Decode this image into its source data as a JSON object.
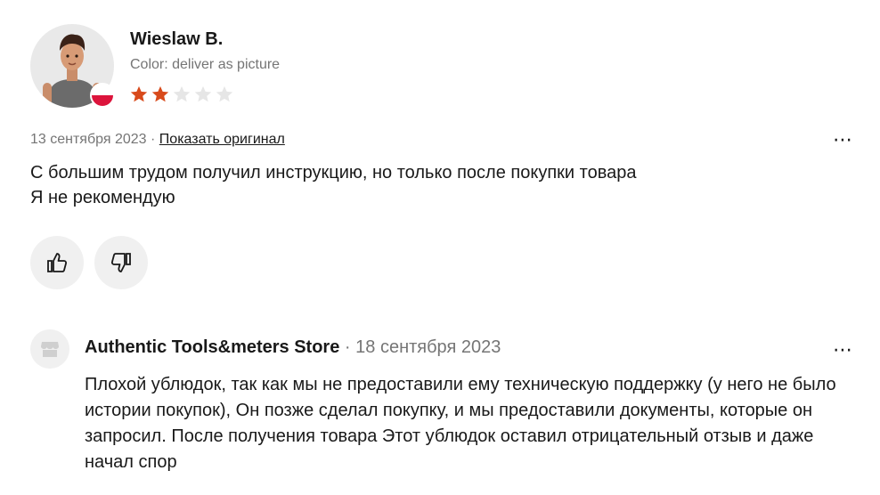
{
  "review": {
    "user_name": "Wieslaw B.",
    "color_label": "Color: deliver as picture",
    "rating": 2,
    "max_rating": 5,
    "star_color_filled": "#d84a1b",
    "star_color_empty": "#e6e6e6",
    "date": "13 сентября 2023",
    "separator": "·",
    "show_original": "Показать оригинал",
    "more_icon": "⋯",
    "text_line1": "С большим трудом получил инструкцию, но только после покупки товара",
    "text_line2": "Я не рекомендую"
  },
  "votes": {
    "like_icon": "thumbs-up-icon",
    "dislike_icon": "thumbs-down-icon"
  },
  "reply": {
    "store_name": "Authentic Tools&meters Store",
    "separator": "·",
    "date": "18 сентября 2023",
    "more_icon": "⋯",
    "text": "Плохой ублюдок, так как мы не предоставили ему техническую поддержку (у него не было истории покупок), Он позже сделал покупку, и мы предоставили документы, которые он запросил. После получения товара Этот ублюдок оставил отрицательный отзыв и даже начал спор"
  }
}
